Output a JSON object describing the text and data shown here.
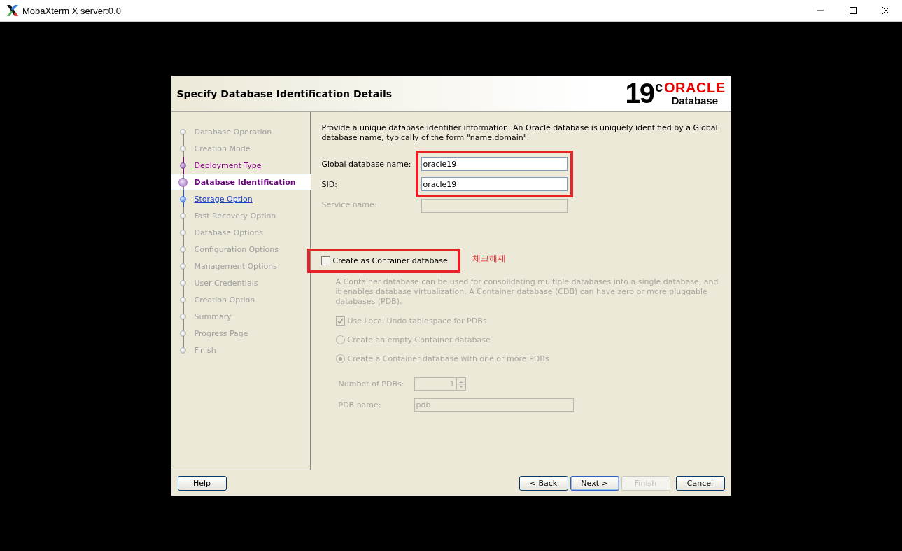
{
  "window": {
    "title": "MobaXterm X server:0.0"
  },
  "dialog": {
    "title": "Specify Database Identification Details",
    "logo": {
      "version": "19",
      "superscript": "c",
      "brand": "ORACLE",
      "product": "Database"
    }
  },
  "steps": [
    {
      "label": "Database Operation",
      "kind": "disabled"
    },
    {
      "label": "Creation Mode",
      "kind": "disabled"
    },
    {
      "label": "Deployment Type",
      "kind": "visited"
    },
    {
      "label": "Database Identification",
      "kind": "current"
    },
    {
      "label": "Storage Option",
      "kind": "link"
    },
    {
      "label": "Fast Recovery Option",
      "kind": "disabled"
    },
    {
      "label": "Database Options",
      "kind": "disabled"
    },
    {
      "label": "Configuration Options",
      "kind": "disabled"
    },
    {
      "label": "Management Options",
      "kind": "disabled"
    },
    {
      "label": "User Credentials",
      "kind": "disabled"
    },
    {
      "label": "Creation Option",
      "kind": "disabled"
    },
    {
      "label": "Summary",
      "kind": "disabled"
    },
    {
      "label": "Progress Page",
      "kind": "disabled"
    },
    {
      "label": "Finish",
      "kind": "disabled"
    }
  ],
  "intro": "Provide a unique database identifier information. An Oracle database is uniquely identified by a Global database name, typically of the form \"name.domain\".",
  "fields": [
    {
      "label": "Global database name:",
      "value": "oracle19",
      "disabled": false
    },
    {
      "label": "SID:",
      "value": "oracle19",
      "disabled": false
    },
    {
      "label": "Service name:",
      "disabled": true
    }
  ],
  "container": {
    "label": "Create as Container database",
    "checked": false,
    "annotation": "체크해제",
    "description": "A Container database can be used for consolidating multiple databases into a single database, and it enables database virtualization. A Container database (CDB) can have zero or more pluggable databases (PDB).",
    "local_undo": {
      "label": "Use Local Undo tablespace for PDBs",
      "checked": true
    },
    "options": [
      {
        "label": "Create an empty Container database",
        "selected": false
      },
      {
        "label": "Create a Container database with one or more PDBs",
        "selected": true
      }
    ],
    "pdb_count": {
      "label": "Number of PDBs:",
      "value": "1"
    },
    "pdb_name": {
      "label": "PDB name:",
      "value": "pdb"
    }
  },
  "buttons": [
    {
      "label": "Help",
      "kind": "help",
      "disabled": false,
      "default": false
    },
    {
      "label": "< Back",
      "kind": "nav",
      "disabled": false,
      "default": false
    },
    {
      "label": "Next >",
      "kind": "nav",
      "disabled": false,
      "default": true
    },
    {
      "label": "Finish",
      "kind": "nav",
      "disabled": true,
      "default": false
    },
    {
      "label": "Cancel",
      "kind": "cancel",
      "disabled": false,
      "default": false
    }
  ]
}
